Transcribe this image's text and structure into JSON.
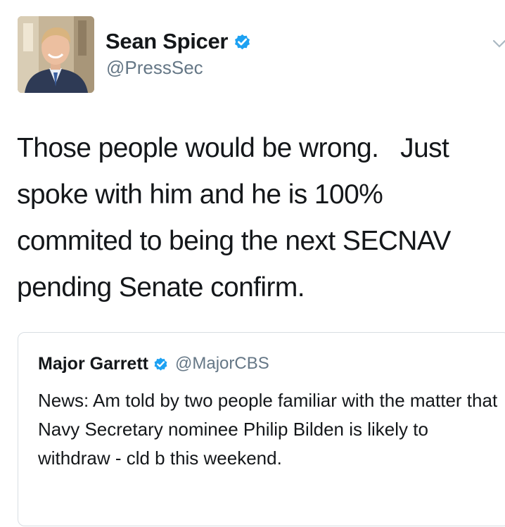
{
  "author": {
    "display_name": "Sean Spicer",
    "handle": "@PressSec",
    "verified": true,
    "avatar_icon": "profile-photo"
  },
  "tweet": {
    "text": "Those people would be wrong.   Just spoke with him and he is 100% commited to being the next SECNAV pending Senate confirm."
  },
  "quoted_tweet": {
    "display_name": "Major Garrett",
    "handle": "@MajorCBS",
    "verified": true,
    "text": "News: Am told by two people familiar with the matter that Navy Secretary nominee Philip Bilden is likely to withdraw - cld b this weekend."
  },
  "colors": {
    "verified_badge": "#1da1f2",
    "handle_gray": "#657786",
    "text": "#14171a",
    "border": "#d8dee3"
  }
}
